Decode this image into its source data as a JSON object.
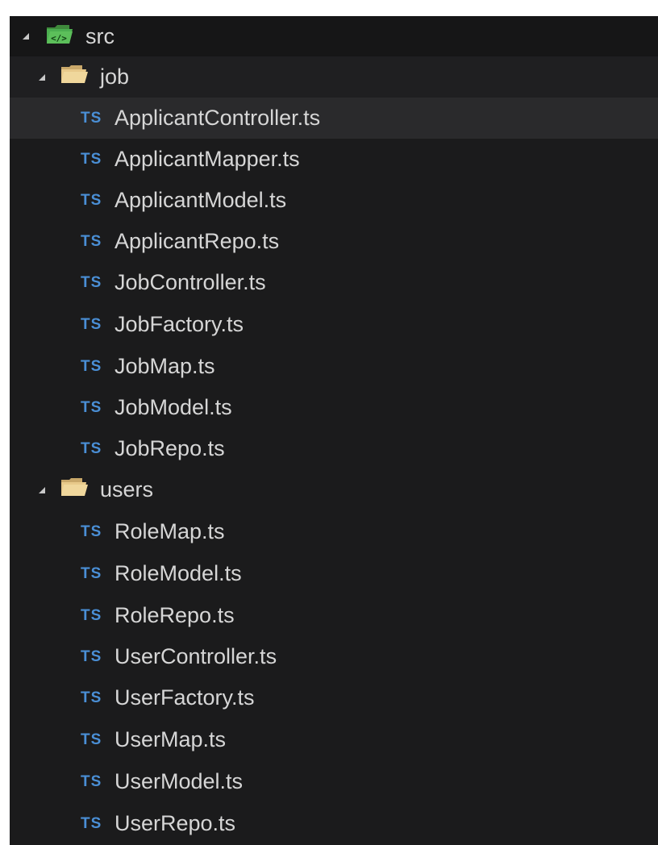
{
  "tree": {
    "root": {
      "label": "src",
      "icon": "source-folder-icon",
      "expanded": true
    },
    "folders": [
      {
        "label": "job",
        "icon": "folder-open-icon",
        "expanded": true,
        "files": [
          "ApplicantController.ts",
          "ApplicantMapper.ts",
          "ApplicantModel.ts",
          "ApplicantRepo.ts",
          "JobController.ts",
          "JobFactory.ts",
          "JobMap.ts",
          "JobModel.ts",
          "JobRepo.ts"
        ]
      },
      {
        "label": "users",
        "icon": "folder-open-icon",
        "expanded": true,
        "files": [
          "RoleMap.ts",
          "RoleModel.ts",
          "RoleRepo.ts",
          "UserController.ts",
          "UserFactory.ts",
          "UserMap.ts",
          "UserModel.ts",
          "UserRepo.ts"
        ]
      }
    ],
    "file_badge": "TS",
    "selected_file": "ApplicantController.ts"
  },
  "colors": {
    "background": "#1b1b1c",
    "selected_row": "#2a2a2c",
    "ts_badge": "#4a8fd6",
    "folder": "#e8c98a",
    "source_folder": "#4caf50",
    "text": "#d6d6d6"
  }
}
